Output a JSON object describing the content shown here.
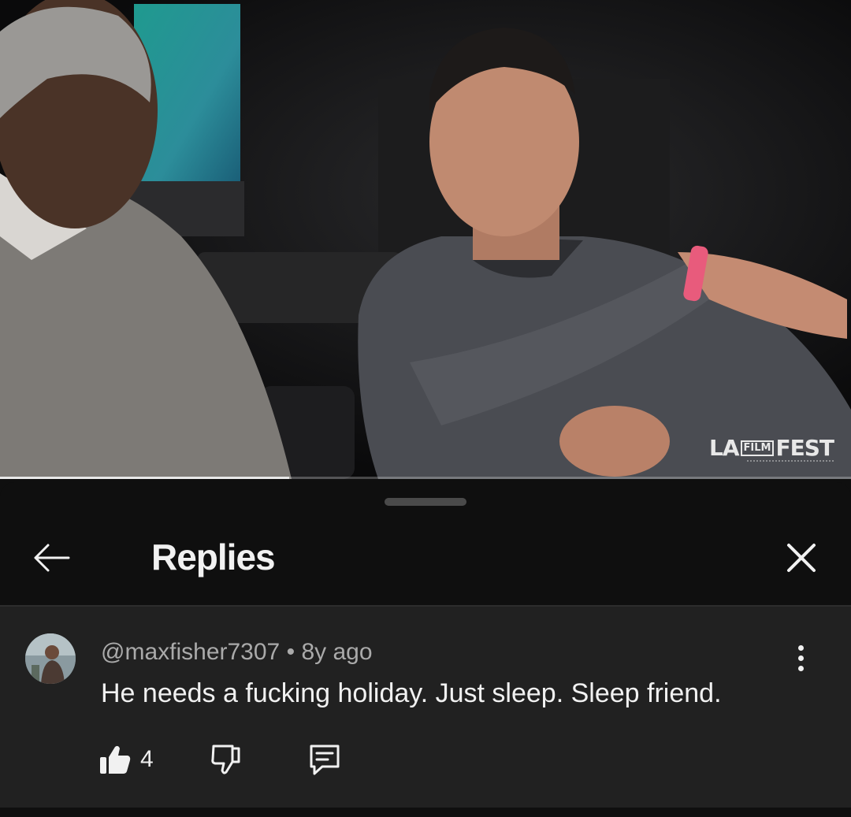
{
  "video": {
    "watermark_left": "LA",
    "watermark_boxed": "FILM",
    "watermark_right": "FEST",
    "progress_fraction": 0.34
  },
  "sheet": {
    "title": "Replies"
  },
  "comment": {
    "author": "@maxfisher7307",
    "separator": "•",
    "age": "8y ago",
    "text": "He needs a fucking holiday. Just sleep. Sleep friend.",
    "like_count": "4"
  },
  "icons": {
    "back": "arrow-left-icon",
    "close": "close-icon",
    "more": "more-vert-icon",
    "like": "thumb-up-filled-icon",
    "dislike": "thumb-down-outline-icon",
    "reply": "comment-icon"
  },
  "colors": {
    "background": "#0f0f0f",
    "comment_background": "#212121",
    "primary_text": "#f1f1f1",
    "secondary_text": "#aaaaaa"
  }
}
